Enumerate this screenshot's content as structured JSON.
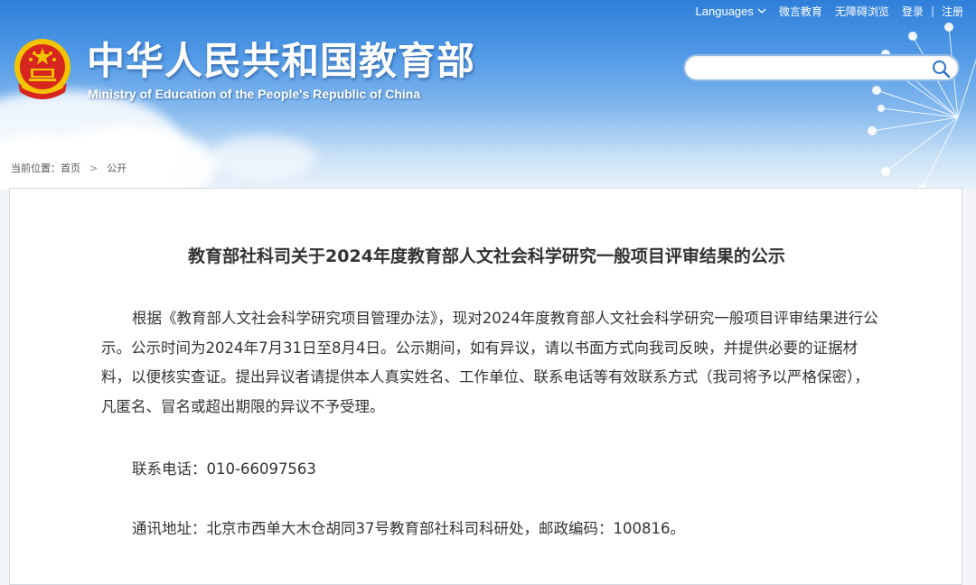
{
  "header": {
    "links": {
      "languages": "Languages",
      "weiyan": "微言教育",
      "accessible": "无障碍浏览",
      "login": "登录",
      "register": "注册"
    },
    "title_cn": "中华人民共和国教育部",
    "title_en": "Ministry of Education of the People's Republic of China",
    "search": {
      "placeholder": "",
      "value": ""
    }
  },
  "breadcrumb": {
    "label": "当前位置：",
    "items": [
      "首页",
      "公开"
    ]
  },
  "article": {
    "title": "教育部社科司关于2024年度教育部人文社会科学研究一般项目评审结果的公示",
    "paragraph": "根据《教育部人文社会科学研究项目管理办法》，现对2024年度教育部人文社会科学研究一般项目评审结果进行公示。公示时间为2024年7月31日至8月4日。公示期间，如有异议，请以书面方式向我司反映，并提供必要的证据材料，以便核实查证。提出异议者请提供本人真实姓名、工作单位、联系电话等有效联系方式（我司将予以严格保密），凡匿名、冒名或超出期限的异议不予受理。",
    "phone": "联系电话：010-66097563",
    "address": "通讯地址：北京市西单大木仓胡同37号教育部社科司科研处，邮政编码：100816。"
  },
  "colors": {
    "sky_top": "#2f7fd9",
    "emblem_red": "#d7261f",
    "emblem_gold": "#f5c400",
    "text": "#333333"
  },
  "icons": [
    "emblem-icon",
    "chevron-down-icon",
    "search-icon"
  ]
}
